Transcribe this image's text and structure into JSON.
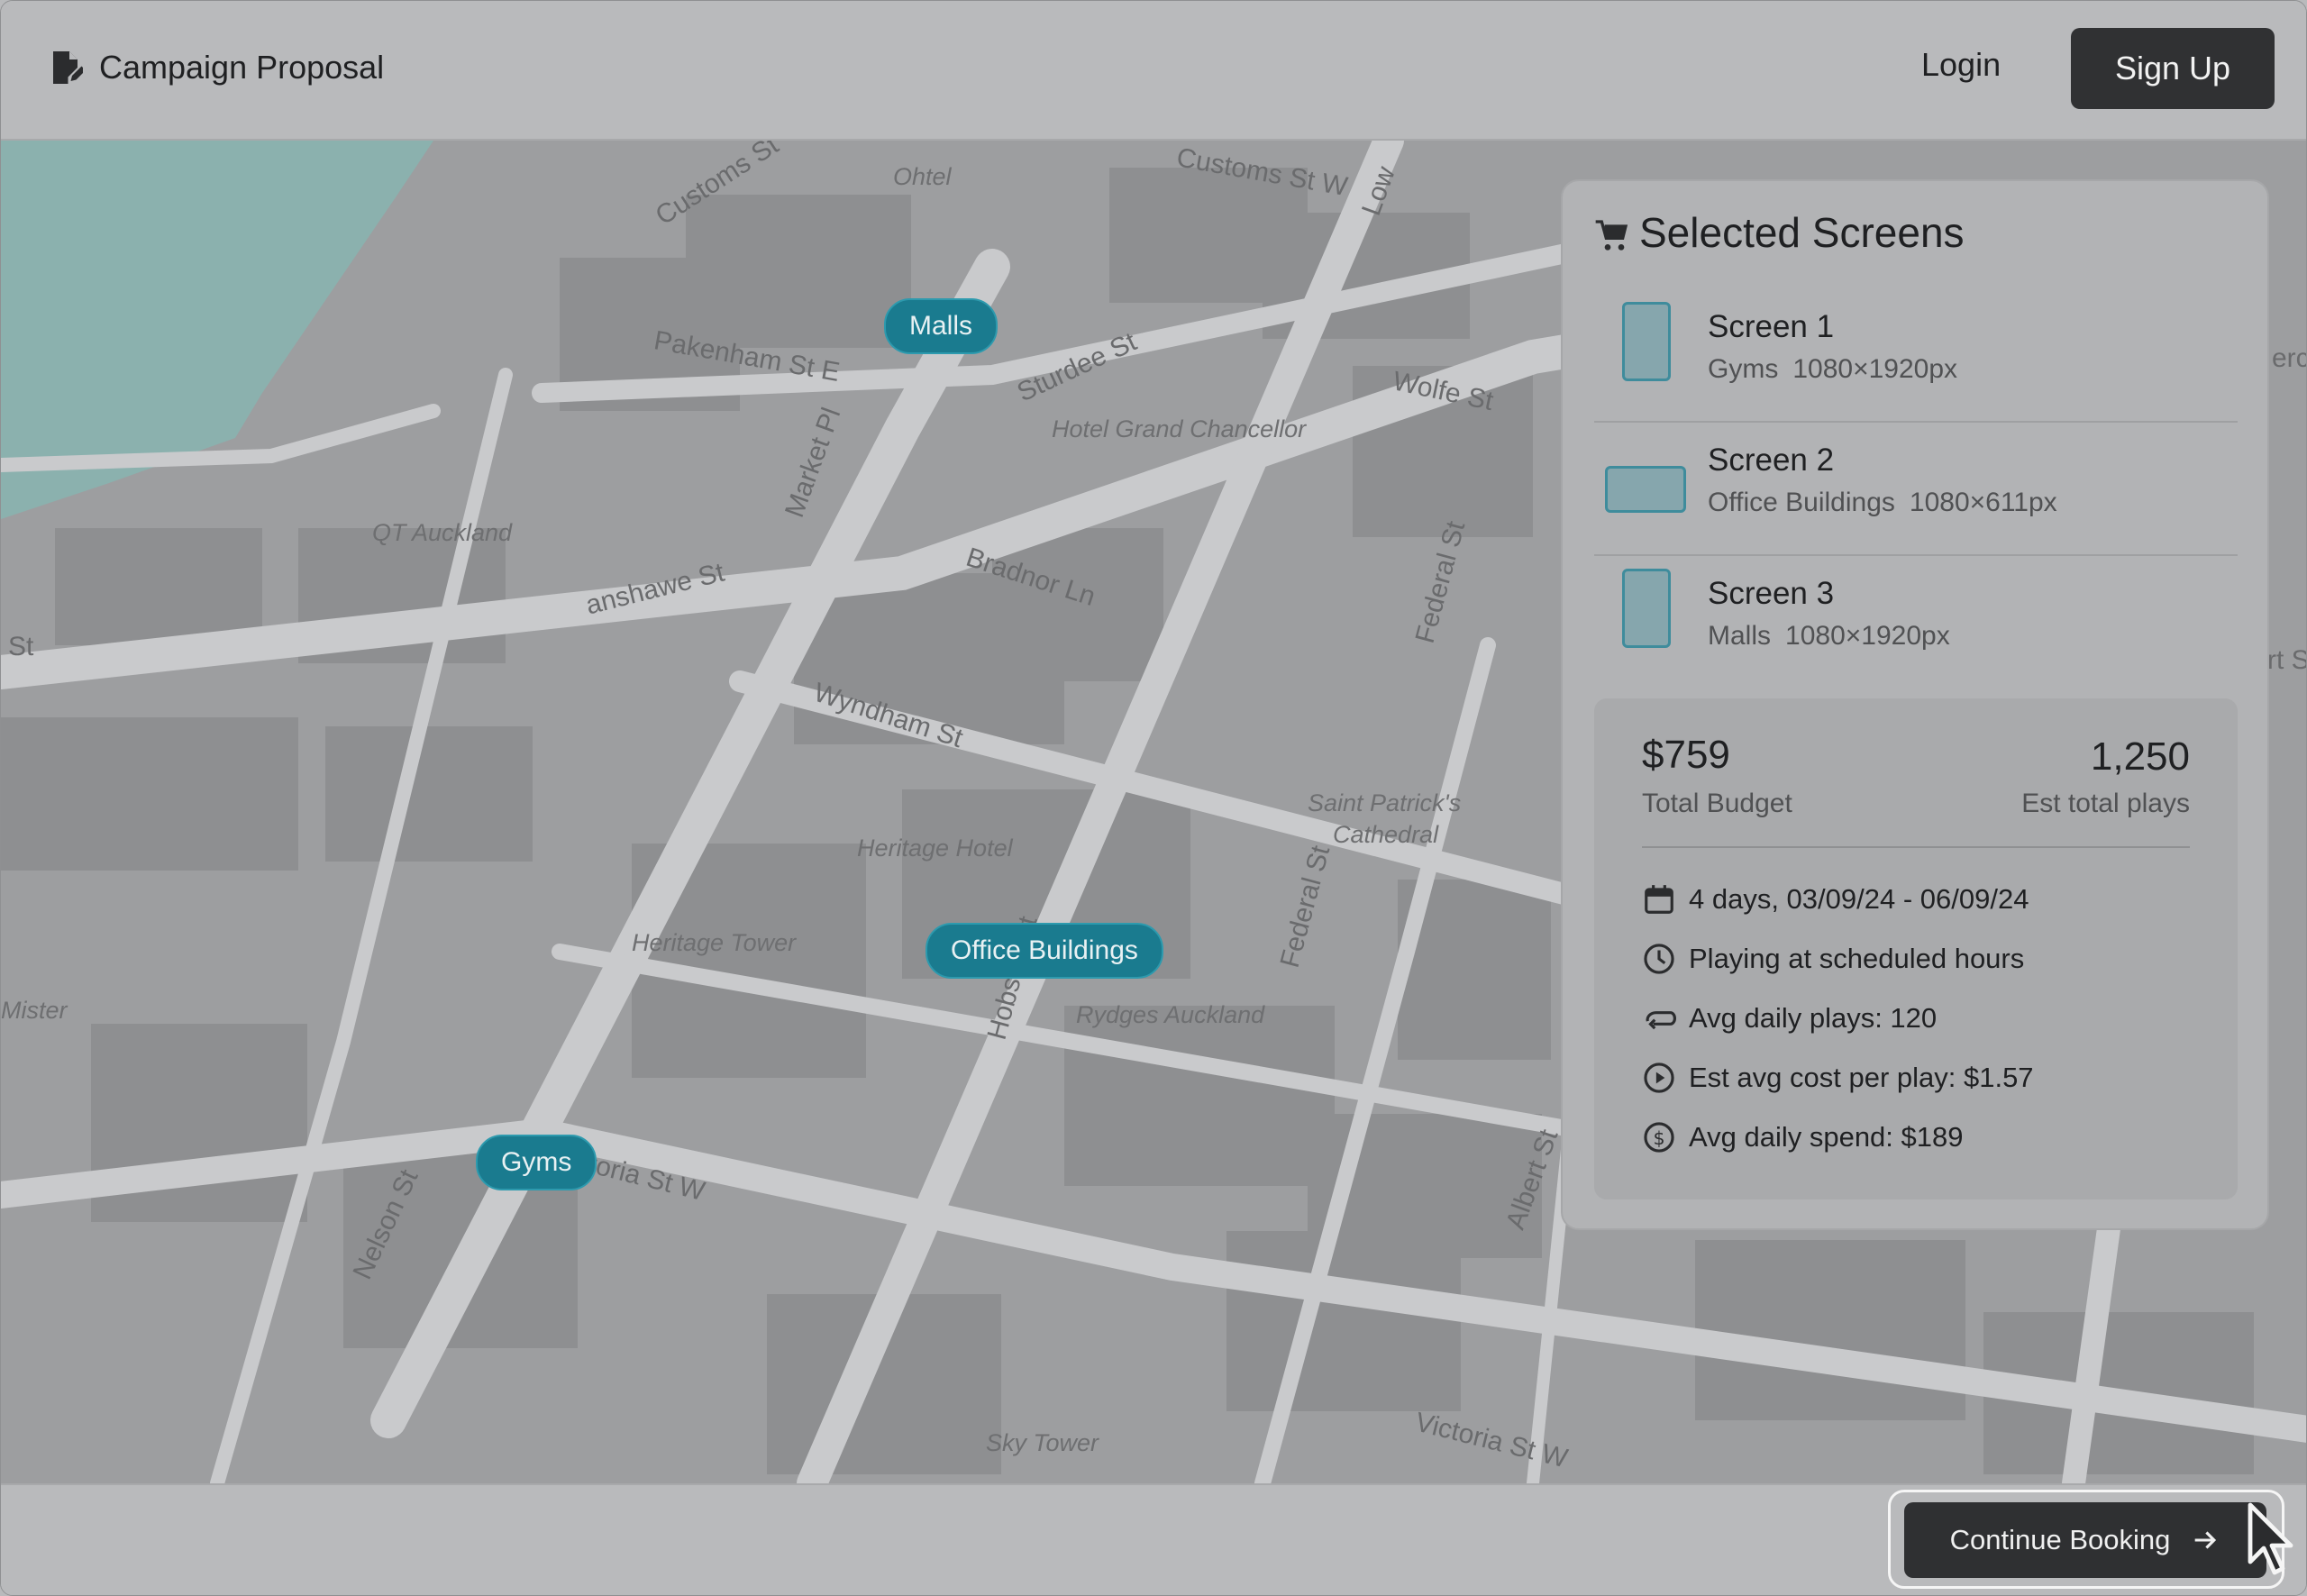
{
  "header": {
    "brand_icon": "document-edit-icon",
    "title": "Campaign Proposal",
    "login_label": "Login",
    "signup_label": "Sign Up"
  },
  "map": {
    "place_labels": [
      "Ohtel",
      "Hotel Grand Chancellor",
      "QT Auckland",
      "Heritage Hotel",
      "Heritage Tower",
      "Rydges Auckland",
      "Saint Patrick's",
      "Cathedral",
      "Sky Tower",
      "Mister"
    ],
    "street_labels": [
      "Customs St",
      "Customs St W",
      "Pakenham St E",
      "Sturdee St",
      "Wolfe St",
      "Market Pl",
      "anshawe St",
      "St",
      "Bradnor Ln",
      "Wyndham St",
      "Federal St",
      "Federal St",
      "Hobson St",
      "Nelson St",
      "ctoria St W",
      "Albert St",
      "Victoria St W",
      "Low",
      "erc",
      "rt St"
    ],
    "pins": [
      {
        "label": "Malls",
        "color": "#1a7b8f"
      },
      {
        "label": "Office Buildings",
        "color": "#1a7b8f"
      },
      {
        "label": "Gyms",
        "color": "#1a7b8f"
      }
    ]
  },
  "panel": {
    "icon": "cart-icon",
    "title": "Selected Screens",
    "screens": [
      {
        "name": "Screen 1",
        "category": "Gyms",
        "resolution": "1080×1920px",
        "orientation": "portrait"
      },
      {
        "name": "Screen 2",
        "category": "Office Buildings",
        "resolution": "1080×611px",
        "orientation": "landscape"
      },
      {
        "name": "Screen 3",
        "category": "Malls",
        "resolution": "1080×1920px",
        "orientation": "portrait"
      }
    ],
    "summary": {
      "total_budget_value": "$759",
      "total_budget_label": "Total Budget",
      "plays_value": "1,250",
      "plays_label": "Est total plays",
      "details": [
        {
          "icon": "calendar-icon",
          "text": "4 days, 03/09/24 - 06/09/24"
        },
        {
          "icon": "clock-icon",
          "text": "Playing at scheduled hours"
        },
        {
          "icon": "repeat-icon",
          "text": "Avg daily plays: 120"
        },
        {
          "icon": "play-circle-icon",
          "text": "Est avg cost per play: $1.57"
        },
        {
          "icon": "dollar-circle-icon",
          "text": "Avg daily spend: $189"
        }
      ]
    }
  },
  "footer": {
    "cta_label": "Continue Booking",
    "cta_icon": "arrow-right-icon"
  },
  "colors": {
    "accent": "#1a7b8f",
    "dark_button": "#303133"
  }
}
